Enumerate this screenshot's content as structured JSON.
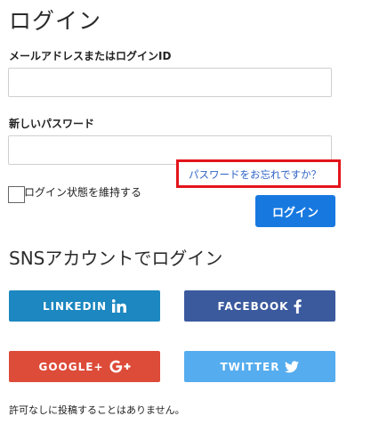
{
  "login": {
    "title": "ログイン",
    "email_label": "メールアドレスまたはログインID",
    "email_value": "",
    "password_label": "新しいパスワード",
    "password_value": "",
    "forgot_link": "パスワードをお忘れですか？",
    "remember_label": "ログイン状態を維持する",
    "remember_checked": false,
    "submit_label": "ログイン",
    "highlight_color": "#e3141b"
  },
  "sns": {
    "title": "SNSアカウントでログイン",
    "buttons": [
      {
        "label": "LINKEDIN",
        "icon": "linkedin-icon",
        "color": "#1c87c0"
      },
      {
        "label": "FACEBOOK",
        "icon": "facebook-icon",
        "color": "#3b5a9e"
      },
      {
        "label": "GOOGLE+",
        "icon": "google-plus-icon",
        "color": "#dd4b39"
      },
      {
        "label": "TWITTER",
        "icon": "twitter-icon",
        "color": "#55acee"
      }
    ]
  },
  "footer": {
    "notice": "許可なしに投稿することはありません。"
  }
}
